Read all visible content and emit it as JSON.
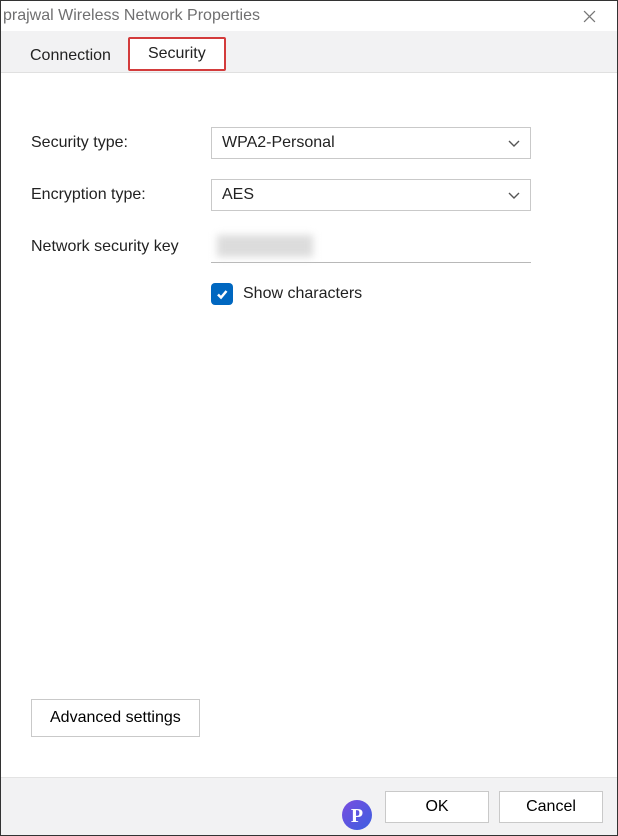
{
  "titlebar": {
    "title": "prajwal Wireless Network Properties"
  },
  "tabs": {
    "connection": "Connection",
    "security": "Security"
  },
  "form": {
    "security_type_label": "Security type:",
    "security_type_value": "WPA2-Personal",
    "encryption_type_label": "Encryption type:",
    "encryption_type_value": "AES",
    "network_key_label": "Network security key",
    "network_key_value": "",
    "show_characters_label": "Show characters",
    "show_characters_checked": true,
    "advanced_settings": "Advanced settings"
  },
  "footer": {
    "ok": "OK",
    "cancel": "Cancel"
  }
}
